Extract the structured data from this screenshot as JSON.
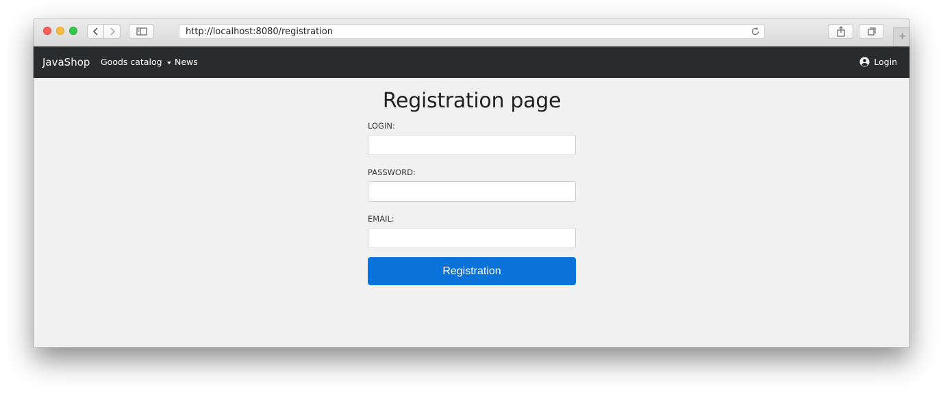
{
  "browser": {
    "url": "http://localhost:8080/registration"
  },
  "navbar": {
    "brand": "JavaShop",
    "catalog_label": "Goods catalog",
    "news_label": "News",
    "login_label": "Login"
  },
  "page": {
    "title": "Registration page",
    "fields": {
      "login_label": "LOGIN:",
      "login_value": "",
      "password_label": "PASSWORD:",
      "password_value": "",
      "email_label": "EMAIL:",
      "email_value": ""
    },
    "submit_label": "Registration"
  },
  "colors": {
    "navbar_bg": "#2a2b2d",
    "page_bg": "#f1f1f1",
    "primary_button": "#0a73d9"
  },
  "icons": {
    "back": "chevron-left-icon",
    "forward": "chevron-right-icon",
    "sidebar": "sidebar-icon",
    "reload": "reload-icon",
    "share": "share-icon",
    "tabs": "tabs-icon",
    "user": "user-circle-icon"
  }
}
